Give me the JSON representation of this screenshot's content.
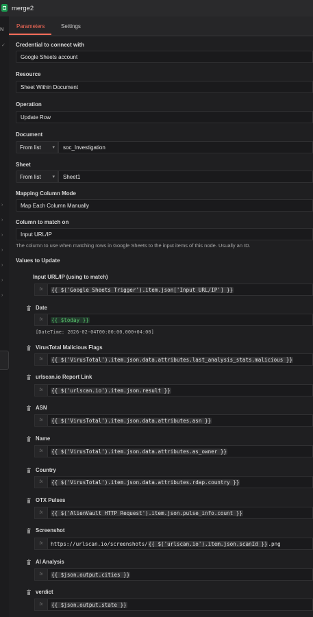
{
  "header": {
    "title": "merge2"
  },
  "tabs": {
    "parameters": "Parameters",
    "settings": "Settings"
  },
  "rail": {
    "tag": "N"
  },
  "credential": {
    "label": "Credential to connect with",
    "value": "Google Sheets account"
  },
  "resource": {
    "label": "Resource",
    "value": "Sheet Within Document"
  },
  "operation": {
    "label": "Operation",
    "value": "Update Row"
  },
  "document": {
    "label": "Document",
    "mode": "From list",
    "value": "soc_Investigation"
  },
  "sheet": {
    "label": "Sheet",
    "mode": "From list",
    "value": "Sheet1"
  },
  "mapping": {
    "label": "Mapping Column Mode",
    "value": "Map Each Column Manually"
  },
  "match_column": {
    "label": "Column to match on",
    "value": "Input URL/IP",
    "hint": "The column to use when matching rows in Google Sheets to the input items of this node. Usually an ID."
  },
  "values_to_update": {
    "label": "Values to Update"
  },
  "fields": [
    {
      "name": "Input URL/IP (using to match)",
      "expr": "{{ $('Google Sheets Trigger').item.json['Input URL/IP'] }}"
    },
    {
      "name": "Date",
      "expr": "{{ $today }}",
      "result": "[DateTime: 2026-02-04T00:00:00.000+04:00]"
    },
    {
      "name": "VirusTotal Malicious Flags",
      "expr": "{{ $('VirusTotal').item.json.data.attributes.last_analysis_stats.malicious }}"
    },
    {
      "name": "urlscan.io Report Link",
      "expr": "{{ $('urlscan.io').item.json.result }}"
    },
    {
      "name": "ASN",
      "expr": "{{ $('VirusTotal').item.json.data.attributes.asn }}"
    },
    {
      "name": "Name",
      "expr": "{{ $('VirusTotal').item.json.data.attributes.as_owner }}"
    },
    {
      "name": "Country",
      "expr": "{{ $('VirusTotal').item.json.data.attributes.rdap.country }}"
    },
    {
      "name": "OTX Pulses",
      "expr": "{{ $('AlienVault HTTP Request').item.json.pulse_info.count }}"
    },
    {
      "name": "Screenshot",
      "expr_prefix": "https://urlscan.io/screenshots/",
      "expr": "{{ $('urlscan.io').item.json.scanId }}",
      "expr_suffix": ".png"
    },
    {
      "name": "AI Analysis",
      "expr": "{{ $json.output.cities }}"
    },
    {
      "name": "verdict",
      "expr": "{{ $json.output.state }}"
    }
  ],
  "icons": {
    "node": "google-sheets-icon",
    "field_delete": "trash-icon",
    "expression": "fx-icon",
    "dropdown": "chevron-down-icon"
  },
  "colors": {
    "accent": "#ff6d5a",
    "node": "#1d9b52",
    "expression_green": "#58c36b"
  }
}
